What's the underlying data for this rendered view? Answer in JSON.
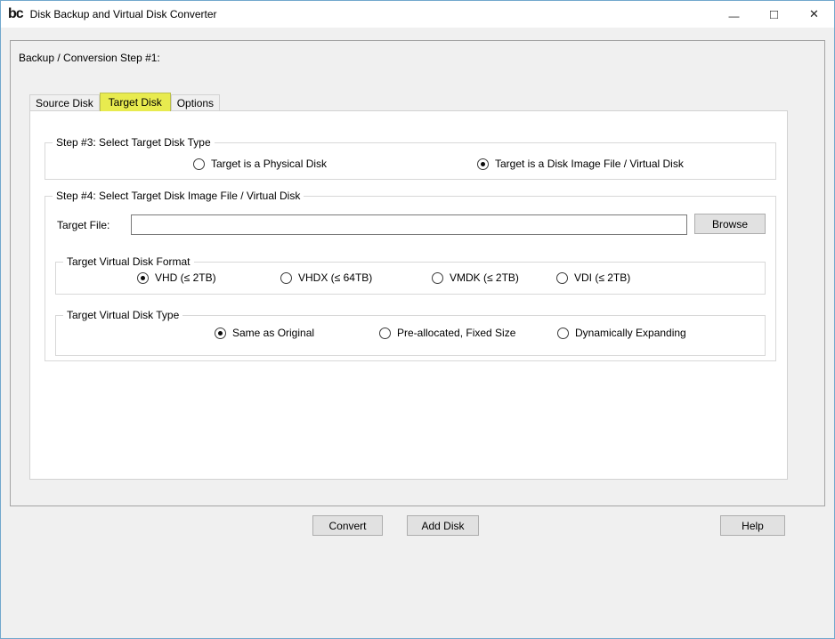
{
  "window": {
    "title": "Disk Backup and Virtual Disk Converter",
    "icon_text": "bc",
    "minimize_glyph": "—",
    "maximize_glyph": "□",
    "close_glyph": "✕"
  },
  "colors": {
    "window_border": "#71a8cd",
    "titlebar_bg": "#ffffff",
    "client_bg": "#f0f0f0",
    "panel_bg": "#ffffff",
    "active_tab_highlight": "#e8eb4f"
  },
  "main_group": {
    "label": "Backup / Conversion Step #1:"
  },
  "tabs": [
    {
      "label": "Source Disk",
      "active": false
    },
    {
      "label": "Target Disk",
      "active": true
    },
    {
      "label": "Options",
      "active": false
    }
  ],
  "step3": {
    "label": "Step #3: Select Target Disk Type",
    "options": [
      {
        "label": "Target is a Physical Disk",
        "selected": false
      },
      {
        "label": "Target is a Disk Image File / Virtual Disk",
        "selected": true
      }
    ]
  },
  "step4": {
    "label": "Step #4: Select Target Disk Image File / Virtual Disk",
    "target_file_label": "Target File:",
    "target_file_value": "",
    "browse_label": "Browse",
    "format": {
      "label": "Target Virtual Disk Format",
      "options": [
        {
          "label": "VHD (≤ 2TB)",
          "selected": true
        },
        {
          "label": "VHDX (≤ 64TB)",
          "selected": false
        },
        {
          "label": "VMDK (≤ 2TB)",
          "selected": false
        },
        {
          "label": "VDI (≤ 2TB)",
          "selected": false
        }
      ]
    },
    "disk_type": {
      "label": "Target Virtual Disk Type",
      "options": [
        {
          "label": "Same as Original",
          "selected": true
        },
        {
          "label": "Pre-allocated, Fixed Size",
          "selected": false
        },
        {
          "label": "Dynamically Expanding",
          "selected": false
        }
      ]
    }
  },
  "footer": {
    "convert_label": "Convert",
    "add_disk_label": "Add Disk",
    "help_label": "Help"
  }
}
